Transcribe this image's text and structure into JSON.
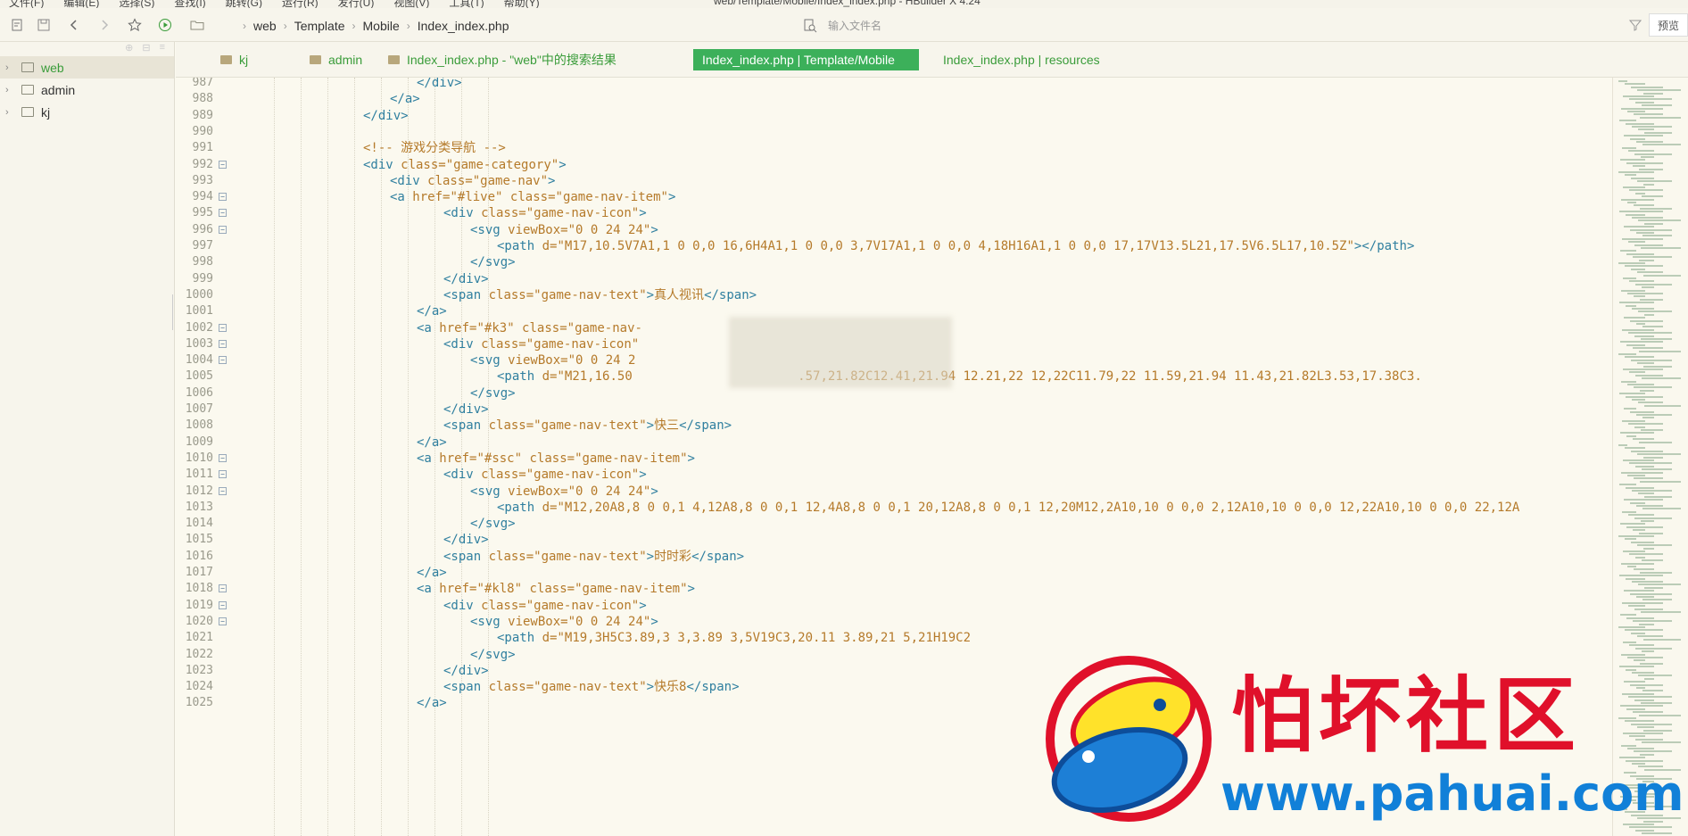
{
  "menubar": {
    "items": [
      "文件(F)",
      "编辑(E)",
      "选择(S)",
      "查找(I)",
      "跳转(G)",
      "运行(R)",
      "发行(U)",
      "视图(V)",
      "工具(T)",
      "帮助(Y)"
    ],
    "title": "web/Template/Mobile/Index_index.php - HBuilder X 4.24"
  },
  "breadcrumb": [
    "web",
    "Template",
    "Mobile",
    "Index_index.php"
  ],
  "file_search": {
    "placeholder": "输入文件名"
  },
  "preview_label": "预览",
  "sidebar": {
    "items": [
      {
        "label": "web",
        "active": true
      },
      {
        "label": "admin",
        "active": false
      },
      {
        "label": "kj",
        "active": false
      }
    ]
  },
  "tabs": [
    {
      "label": "kj",
      "folder": true,
      "active": false
    },
    {
      "label": "admin",
      "folder": true,
      "active": false
    },
    {
      "label": "Index_index.php - \"web\"中的搜索结果",
      "folder": true,
      "active": false
    },
    {
      "label": "Index_index.php | Template/Mobile",
      "folder": false,
      "active": true
    },
    {
      "label": "Index_index.php | resources",
      "folder": false,
      "active": false
    }
  ],
  "code_lines": [
    {
      "num": "987",
      "fold": false,
      "indent": 8,
      "text": "</div>"
    },
    {
      "num": "988",
      "fold": false,
      "indent": 7,
      "text": "</a>"
    },
    {
      "num": "989",
      "fold": false,
      "indent": 6,
      "text": "</div>"
    },
    {
      "num": "990",
      "fold": false,
      "indent": 0,
      "text": ""
    },
    {
      "num": "991",
      "fold": false,
      "indent": 6,
      "text": "<!-- 游戏分类导航 -->"
    },
    {
      "num": "992",
      "fold": true,
      "indent": 6,
      "text": "<div class=\"game-category\">"
    },
    {
      "num": "993",
      "fold": false,
      "indent": 7,
      "text": "<div class=\"game-nav\">"
    },
    {
      "num": "994",
      "fold": true,
      "indent": 7,
      "text": "<a href=\"#live\" class=\"game-nav-item\">"
    },
    {
      "num": "995",
      "fold": true,
      "indent": 9,
      "text": "<div class=\"game-nav-icon\">"
    },
    {
      "num": "996",
      "fold": true,
      "indent": 10,
      "text": "<svg viewBox=\"0 0 24 24\">"
    },
    {
      "num": "997",
      "fold": false,
      "indent": 11,
      "text": "<path d=\"M17,10.5V7A1,1 0 0,0 16,6H4A1,1 0 0,0 3,7V17A1,1 0 0,0 4,18H16A1,1 0 0,0 17,17V13.5L21,17.5V6.5L17,10.5Z\"></path>"
    },
    {
      "num": "998",
      "fold": false,
      "indent": 10,
      "text": "</svg>"
    },
    {
      "num": "999",
      "fold": false,
      "indent": 9,
      "text": "</div>"
    },
    {
      "num": "1000",
      "fold": false,
      "indent": 9,
      "text": "<span class=\"game-nav-text\">真人视讯</span>"
    },
    {
      "num": "1001",
      "fold": false,
      "indent": 8,
      "text": "</a>"
    },
    {
      "num": "1002",
      "fold": true,
      "indent": 8,
      "text": "<a href=\"#k3\" class=\"game-nav-"
    },
    {
      "num": "1003",
      "fold": true,
      "indent": 9,
      "text": "<div class=\"game-nav-icon\""
    },
    {
      "num": "1004",
      "fold": true,
      "indent": 10,
      "text": "<svg viewBox=\"0 0 24 2"
    },
    {
      "num": "1005",
      "fold": false,
      "indent": 11,
      "text": "<path d=\"M21,16.50                      .57,21.82C12.41,21.94 12.21,22 12,22C11.79,22 11.59,21.94 11.43,21.82L3.53,17.38C3."
    },
    {
      "num": "1006",
      "fold": false,
      "indent": 10,
      "text": "</svg>"
    },
    {
      "num": "1007",
      "fold": false,
      "indent": 9,
      "text": "</div>"
    },
    {
      "num": "1008",
      "fold": false,
      "indent": 9,
      "text": "<span class=\"game-nav-text\">快三</span>"
    },
    {
      "num": "1009",
      "fold": false,
      "indent": 8,
      "text": "</a>"
    },
    {
      "num": "1010",
      "fold": true,
      "indent": 8,
      "text": "<a href=\"#ssc\" class=\"game-nav-item\">"
    },
    {
      "num": "1011",
      "fold": true,
      "indent": 9,
      "text": "<div class=\"game-nav-icon\">"
    },
    {
      "num": "1012",
      "fold": true,
      "indent": 10,
      "text": "<svg viewBox=\"0 0 24 24\">"
    },
    {
      "num": "1013",
      "fold": false,
      "indent": 11,
      "text": "<path d=\"M12,20A8,8 0 0,1 4,12A8,8 0 0,1 12,4A8,8 0 0,1 20,12A8,8 0 0,1 12,20M12,2A10,10 0 0,0 2,12A10,10 0 0,0 12,22A10,10 0 0,0 22,12A"
    },
    {
      "num": "1014",
      "fold": false,
      "indent": 10,
      "text": "</svg>"
    },
    {
      "num": "1015",
      "fold": false,
      "indent": 9,
      "text": "</div>"
    },
    {
      "num": "1016",
      "fold": false,
      "indent": 9,
      "text": "<span class=\"game-nav-text\">时时彩</span>"
    },
    {
      "num": "1017",
      "fold": false,
      "indent": 8,
      "text": "</a>"
    },
    {
      "num": "1018",
      "fold": true,
      "indent": 8,
      "text": "<a href=\"#kl8\" class=\"game-nav-item\">"
    },
    {
      "num": "1019",
      "fold": true,
      "indent": 9,
      "text": "<div class=\"game-nav-icon\">"
    },
    {
      "num": "1020",
      "fold": true,
      "indent": 10,
      "text": "<svg viewBox=\"0 0 24 24\">"
    },
    {
      "num": "1021",
      "fold": false,
      "indent": 11,
      "text": "<path d=\"M19,3H5C3.89,3 3,3.89 3,5V19C3,20.11 3.89,21 5,21H19C2"
    },
    {
      "num": "1022",
      "fold": false,
      "indent": 10,
      "text": "</svg>"
    },
    {
      "num": "1023",
      "fold": false,
      "indent": 9,
      "text": "</div>"
    },
    {
      "num": "1024",
      "fold": false,
      "indent": 9,
      "text": "<span class=\"game-nav-text\">快乐8</span>"
    },
    {
      "num": "1025",
      "fold": false,
      "indent": 8,
      "text": "</a>"
    }
  ],
  "watermark": {
    "text": "怕坏社区",
    "url": "www.pahuai.com"
  },
  "colors": {
    "accent": "#3cb05a",
    "tag": "#2f7f9f",
    "attr": "#2f7f9f",
    "attr_italic": "#2f7f9f",
    "string": "#2a8a2a",
    "comment": "#b57a2a",
    "text": "#333333"
  }
}
